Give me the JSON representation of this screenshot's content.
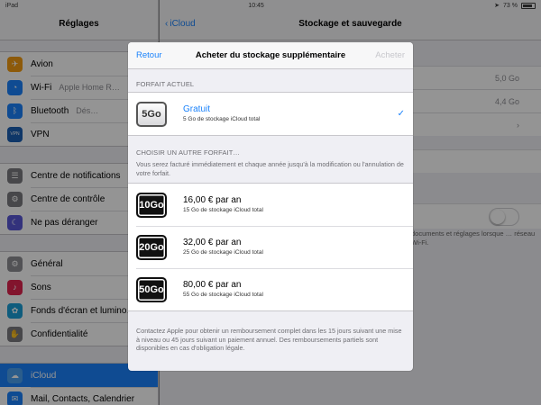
{
  "status_bar": {
    "left": "iPad",
    "time": "10:45",
    "battery": "73 %"
  },
  "sidebar": {
    "title": "Réglages",
    "groups": [
      [
        {
          "label": "Avion",
          "value": "",
          "color": "#f39c12",
          "icon": "airplane-icon",
          "glyph": "✈"
        },
        {
          "label": "Wi-Fi",
          "value": "Apple Home R…",
          "color": "#1a82fb",
          "icon": "wifi-icon",
          "glyph": "◔"
        },
        {
          "label": "Bluetooth",
          "value": "Dés…",
          "color": "#1a82fb",
          "icon": "bluetooth-icon",
          "glyph": "ᛒ"
        },
        {
          "label": "VPN",
          "value": "",
          "color": "#1a5fb4",
          "icon": "vpn-icon",
          "glyph": "VPN"
        }
      ],
      [
        {
          "label": "Centre de notifications",
          "value": "",
          "color": "#7b7b80",
          "icon": "notifications-icon",
          "glyph": "☰"
        },
        {
          "label": "Centre de contrôle",
          "value": "",
          "color": "#7b7b80",
          "icon": "control-center-icon",
          "glyph": "⚙"
        },
        {
          "label": "Ne pas déranger",
          "value": "",
          "color": "#5856d6",
          "icon": "moon-icon",
          "glyph": "☾"
        }
      ],
      [
        {
          "label": "Général",
          "value": "",
          "color": "#8e8e93",
          "icon": "gear-icon",
          "glyph": "⚙"
        },
        {
          "label": "Sons",
          "value": "",
          "color": "#e0234e",
          "icon": "speaker-icon",
          "glyph": "♪"
        },
        {
          "label": "Fonds d'écran et lumino…",
          "value": "",
          "color": "#1a9fd8",
          "icon": "wallpaper-icon",
          "glyph": "✿"
        },
        {
          "label": "Confidentialité",
          "value": "",
          "color": "#7b7b80",
          "icon": "hand-icon",
          "glyph": "✋"
        }
      ],
      [
        {
          "label": "iCloud",
          "value": "",
          "color": "#4aa0f0",
          "icon": "cloud-icon",
          "glyph": "☁",
          "selected": true
        },
        {
          "label": "Mail, Contacts, Calendrier",
          "value": "",
          "color": "#1a82fb",
          "icon": "mail-icon",
          "glyph": "✉"
        }
      ]
    ]
  },
  "detail": {
    "back_label": "iCloud",
    "title": "Stockage et sauvegarde",
    "rows": [
      "5,0 Go",
      "4,4 Go"
    ],
    "note": "documents et réglages lorsque … réseau Wi-Fi."
  },
  "modal": {
    "back_label": "Retour",
    "title": "Acheter du stockage supplémentaire",
    "buy_label": "Acheter",
    "current_header": "Forfait actuel",
    "current_plan": {
      "badge": "5Go",
      "name": "Gratuit",
      "sub": "5 Go de stockage iCloud total"
    },
    "other_header": "Choisir un autre forfait…",
    "other_desc": "Vous serez facturé immédiatement et chaque année jusqu'à la modification ou l'annulation de votre forfait.",
    "plans": [
      {
        "badge": "10Go",
        "price": "16,00 € par an",
        "sub": "15 Go de stockage iCloud total"
      },
      {
        "badge": "20Go",
        "price": "32,00 € par an",
        "sub": "25 Go de stockage iCloud total"
      },
      {
        "badge": "50Go",
        "price": "80,00 € par an",
        "sub": "55 Go de stockage iCloud total"
      }
    ],
    "footer": "Contactez Apple pour obtenir un remboursement complet dans les 15 jours suivant une mise à niveau ou 45 jours suivant un paiement annuel. Des remboursements partiels sont disponibles en cas d'obligation légale."
  },
  "colors": {
    "accent": "#1a82fb",
    "dim_overlay": "rgba(0,0,0,0.42)"
  }
}
